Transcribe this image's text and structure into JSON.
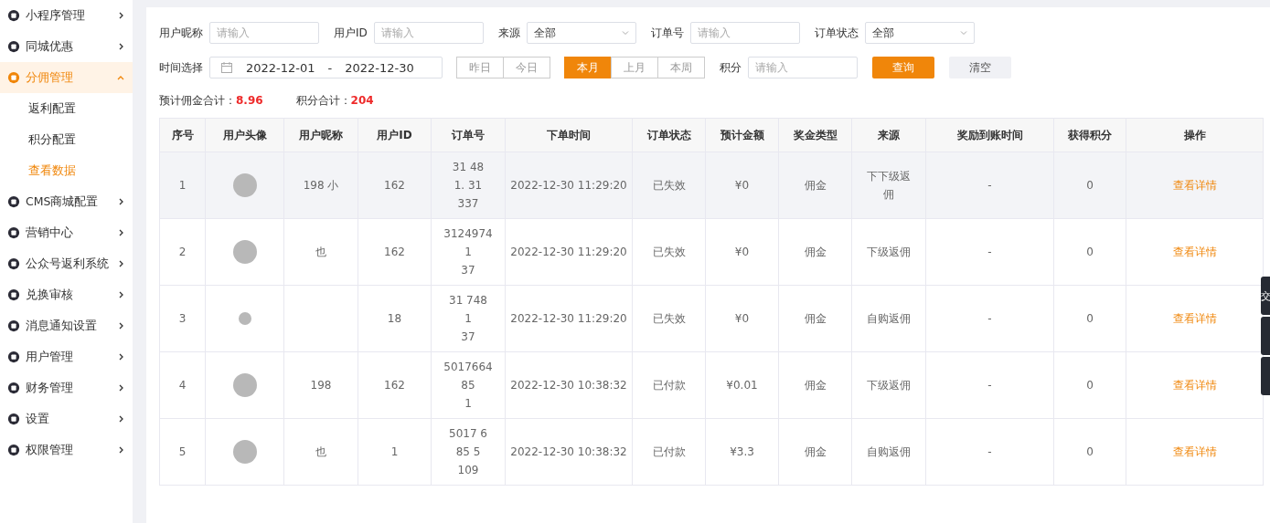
{
  "sidebar": {
    "items": [
      {
        "label": "小程序管理",
        "expanded": false,
        "selected": false
      },
      {
        "label": "同城优惠",
        "expanded": false,
        "selected": false
      },
      {
        "label": "分佣管理",
        "expanded": true,
        "selected": true,
        "children": [
          {
            "label": "返利配置",
            "selected": false
          },
          {
            "label": "积分配置",
            "selected": false
          },
          {
            "label": "查看数据",
            "selected": true
          }
        ]
      },
      {
        "label": "CMS商城配置",
        "expanded": false,
        "selected": false
      },
      {
        "label": "营销中心",
        "expanded": false,
        "selected": false
      },
      {
        "label": "公众号返利系统",
        "expanded": false,
        "selected": false
      },
      {
        "label": "兑换审核",
        "expanded": false,
        "selected": false
      },
      {
        "label": "消息通知设置",
        "expanded": false,
        "selected": false
      },
      {
        "label": "用户管理",
        "expanded": false,
        "selected": false
      },
      {
        "label": "财务管理",
        "expanded": false,
        "selected": false
      },
      {
        "label": "设置",
        "expanded": false,
        "selected": false
      },
      {
        "label": "权限管理",
        "expanded": false,
        "selected": false
      }
    ]
  },
  "filters": [
    {
      "kind": "input",
      "label": "用户昵称",
      "placeholder": "请输入"
    },
    {
      "kind": "input",
      "label": "用户ID",
      "placeholder": "请输入"
    },
    {
      "kind": "select",
      "label": "来源",
      "value": "全部"
    },
    {
      "kind": "input",
      "label": "订单号",
      "placeholder": "请输入"
    },
    {
      "kind": "select",
      "label": "订单状态",
      "value": "全部"
    }
  ],
  "date_filter": {
    "label": "时间选择",
    "start": "2022-12-01",
    "separator": "-",
    "end": "2022-12-30"
  },
  "quick_dates": [
    [
      {
        "label": "昨日",
        "selected": false
      },
      {
        "label": "今日",
        "selected": false
      }
    ],
    [
      {
        "label": "本月",
        "selected": true
      },
      {
        "label": "上月",
        "selected": false
      },
      {
        "label": "本周",
        "selected": false
      }
    ]
  ],
  "points_filter": {
    "label": "积分",
    "placeholder": "请输入"
  },
  "buttons": {
    "query": "查询",
    "clear": "清空"
  },
  "summary": [
    {
      "label": "预计佣金合计：",
      "value": "8.96"
    },
    {
      "label": "积分合计：",
      "value": "204"
    }
  ],
  "table": {
    "columns": [
      "序号",
      "用户头像",
      "用户昵称",
      "用户ID",
      "订单号",
      "下单时间",
      "订单状态",
      "预计金额",
      "奖金类型",
      "来源",
      "奖励到账时间",
      "获得积分",
      "操作"
    ],
    "rows": [
      {
        "hovered": true,
        "index": "1",
        "nickname": [
          "198 小"
        ],
        "user_id": "162",
        "order_no": [
          "31 48",
          "1. 31",
          "337"
        ],
        "time": "2022-12-30 11:29:20",
        "status": "已失效",
        "amount": "¥0",
        "type": "佣金",
        "source": "下下级返佣",
        "arrival": "-",
        "points": "0",
        "action": "查看详情"
      },
      {
        "hovered": false,
        "index": "2",
        "nickname": [
          "也"
        ],
        "user_id": "162",
        "order_no": [
          "3124974",
          "1",
          "37"
        ],
        "time": "2022-12-30 11:29:20",
        "status": "已失效",
        "amount": "¥0",
        "type": "佣金",
        "source": "下级返佣",
        "arrival": "-",
        "points": "0",
        "action": "查看详情"
      },
      {
        "hovered": false,
        "index": "3",
        "user_id": "18",
        "order_no": [
          "31 748",
          "1",
          "37"
        ],
        "time": "2022-12-30 11:29:20",
        "status": "已失效",
        "amount": "¥0",
        "type": "佣金",
        "source": "自购返佣",
        "arrival": "-",
        "points": "0",
        "action": "查看详情"
      },
      {
        "hovered": false,
        "index": "4",
        "nickname": [
          "198"
        ],
        "user_id": "162",
        "order_no": [
          "5017664",
          "85",
          "1"
        ],
        "time": "2022-12-30 10:38:32",
        "status": "已付款",
        "amount": "¥0.01",
        "type": "佣金",
        "source": "下级返佣",
        "arrival": "-",
        "points": "0",
        "action": "查看详情"
      },
      {
        "hovered": false,
        "index": "5",
        "nickname": [
          "也"
        ],
        "user_id": "1",
        "order_no": [
          "5017 6",
          "85 5",
          "109"
        ],
        "time": "2022-12-30 10:38:32",
        "status": "已付款",
        "amount": "¥3.3",
        "type": "佣金",
        "source": "自购返佣",
        "arrival": "-",
        "points": "0",
        "action": "查看详情"
      }
    ]
  },
  "side_tab_label": "交"
}
